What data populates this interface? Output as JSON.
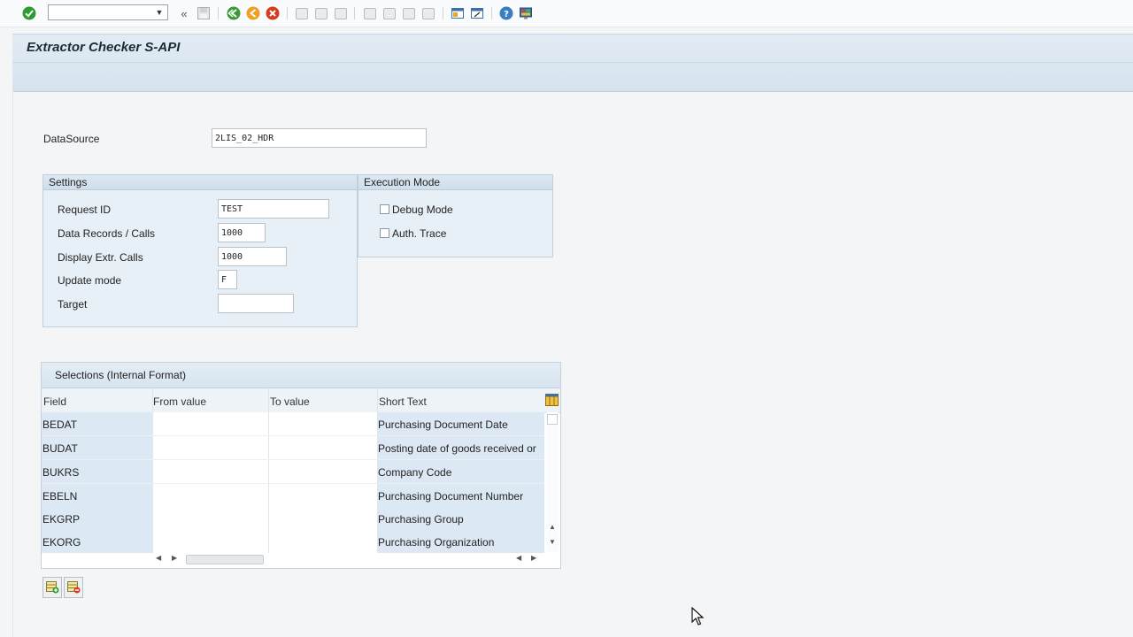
{
  "toolbar": {
    "command_field_value": "",
    "icons": [
      "enter-icon",
      "command-field-dropdown",
      "collapse-icon",
      "save-icon",
      "back-icon",
      "exit-icon",
      "cancel-icon",
      "print-icon",
      "find-icon",
      "find-next-icon",
      "first-page-icon",
      "previous-page-icon",
      "next-page-icon",
      "last-page-icon",
      "new-session-icon",
      "create-shortcut-icon",
      "help-icon",
      "customize-layout-icon"
    ]
  },
  "title": "Extractor Checker S-API",
  "form": {
    "datasource_label": "DataSource",
    "datasource_value": "2LIS_02_HDR"
  },
  "settings": {
    "title": "Settings",
    "request_id_label": "Request ID",
    "request_id_value": "TEST",
    "records_label": "Data Records / Calls",
    "records_value": "1000",
    "display_label": "Display Extr. Calls",
    "display_value": "1000",
    "update_label": "Update mode",
    "update_value": "F",
    "target_label": "Target",
    "target_value": ""
  },
  "execution": {
    "title": "Execution Mode",
    "debug_label": "Debug Mode",
    "debug_checked": false,
    "auth_label": "Auth. Trace",
    "auth_checked": false
  },
  "selections": {
    "title": "Selections (Internal Format)",
    "columns": [
      "Field",
      "From value",
      "To value",
      "Short Text"
    ],
    "rows": [
      {
        "field": "BEDAT",
        "from": "",
        "to": "",
        "text": "Purchasing Document Date"
      },
      {
        "field": "BUDAT",
        "from": "",
        "to": "",
        "text": "Posting date of goods received or"
      },
      {
        "field": "BUKRS",
        "from": "",
        "to": "",
        "text": "Company Code"
      },
      {
        "field": "EBELN",
        "from": "",
        "to": "",
        "text": "Purchasing Document Number"
      },
      {
        "field": "EKGRP",
        "from": "",
        "to": "",
        "text": "Purchasing Group"
      },
      {
        "field": "EKORG",
        "from": "",
        "to": "",
        "text": "Purchasing Organization"
      }
    ]
  },
  "colors": {
    "title_bg": "#d9e5f0",
    "group_bg": "#e8f0f7",
    "key_column_bg": "#dce8f3"
  }
}
